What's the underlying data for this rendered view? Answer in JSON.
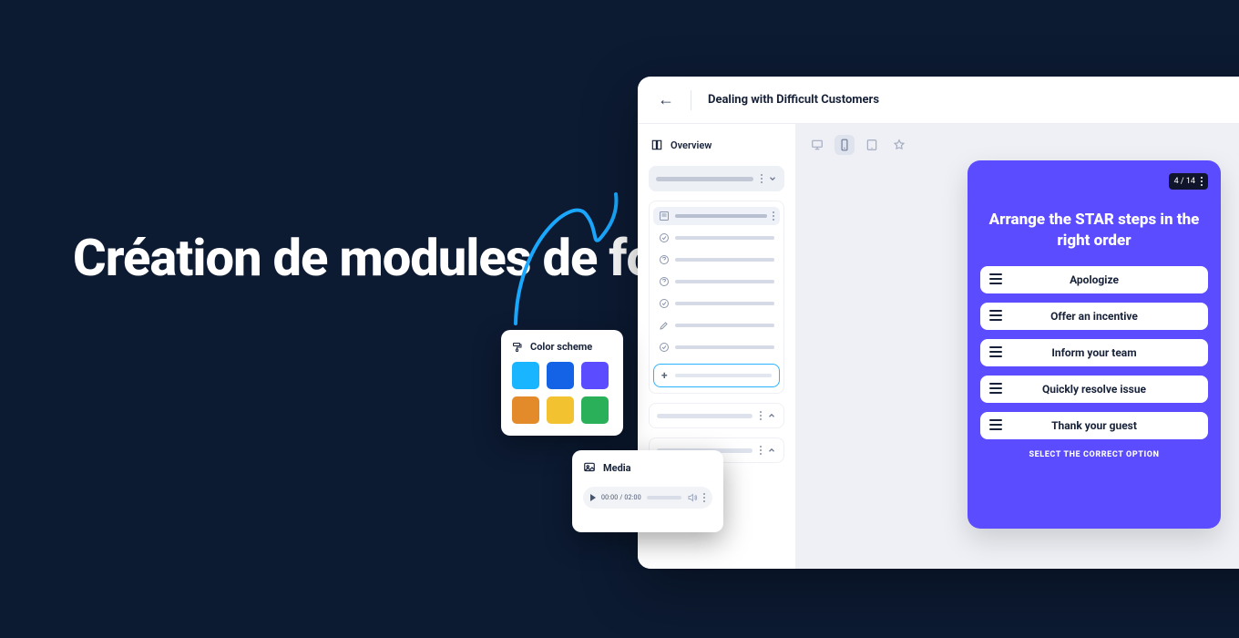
{
  "headline": "Création de modules de formation",
  "app": {
    "title": "Dealing with Difficult Customers",
    "overview_label": "Overview"
  },
  "color_card": {
    "title": "Color scheme"
  },
  "swatches": [
    "#19b6ff",
    "#1463e6",
    "#5b4cff",
    "#e38a2a",
    "#f2c231",
    "#2bb05a"
  ],
  "media_card": {
    "title": "Media",
    "time": "00:00 / 02:00"
  },
  "quiz": {
    "slide_counter": "4 / 14",
    "title": "Arrange the STAR steps in the right order",
    "options": [
      "Apologize",
      "Offer an incentive",
      "Inform your team",
      "Quickly resolve issue",
      "Thank your guest"
    ],
    "footer": "SELECT THE CORRECT OPTION"
  }
}
